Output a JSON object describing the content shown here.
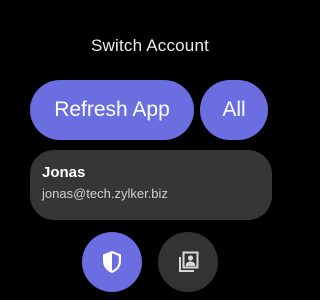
{
  "header": {
    "title": "Switch Account"
  },
  "actions": {
    "refresh_label": "Refresh App",
    "all_label": "All"
  },
  "account": {
    "name": "Jonas",
    "email": "jonas@tech.zylker.biz"
  },
  "bottom_buttons": {
    "security_icon": "shield-icon",
    "accounts_icon": "account-list-icon"
  },
  "colors": {
    "accent": "#6a6ee0",
    "card": "#363636",
    "secondary_button": "#333333",
    "background": "#000000"
  }
}
